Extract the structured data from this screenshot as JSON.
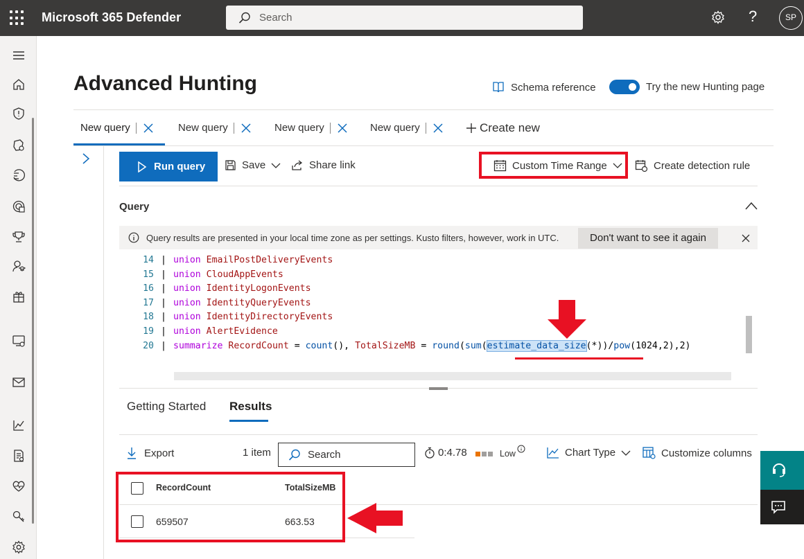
{
  "app": {
    "title": "Microsoft 365 Defender",
    "search_placeholder": "Search",
    "avatar_initials": "SP"
  },
  "nav_icons": [
    "hamburger-icon",
    "home-icon",
    "shield-icon",
    "incidents-icon",
    "hunting-icon",
    "threat-analytics-icon",
    "secure-score-icon",
    "learning-hub-icon",
    "trials-icon",
    "assets-icon",
    "email-icon",
    "reports-icon",
    "audit-icon",
    "health-icon",
    "permissions-icon",
    "settings-icon"
  ],
  "page": {
    "title": "Advanced Hunting",
    "schema_reference": "Schema reference",
    "new_hunting_toggle_label": "Try the new Hunting page",
    "new_hunting_toggle_on": true
  },
  "query_tabs": [
    {
      "label": "New query",
      "active": true
    },
    {
      "label": "New query",
      "active": false
    },
    {
      "label": "New query",
      "active": false
    },
    {
      "label": "New query",
      "active": false
    }
  ],
  "create_new": "Create new",
  "toolbar": {
    "run_query": "Run query",
    "save": "Save",
    "share_link": "Share link",
    "time_range": "Custom Time Range",
    "create_detection_rule": "Create detection rule"
  },
  "query_section": {
    "label": "Query",
    "info_text": "Query results are presented in your local time zone as per settings. Kusto filters, however, work in UTC.",
    "dont_show_button": "Don't want to see it again"
  },
  "code_lines": [
    {
      "n": "14",
      "kw": "union",
      "rest": "EmailPostDeliveryEvents"
    },
    {
      "n": "15",
      "kw": "union",
      "rest": "CloudAppEvents"
    },
    {
      "n": "16",
      "kw": "union",
      "rest": "IdentityLogonEvents"
    },
    {
      "n": "17",
      "kw": "union",
      "rest": "IdentityQueryEvents"
    },
    {
      "n": "18",
      "kw": "union",
      "rest": "IdentityDirectoryEvents"
    },
    {
      "n": "19",
      "kw": "union",
      "rest": "AlertEvidence"
    }
  ],
  "code_last": {
    "n": "20",
    "kw": "summarize",
    "col1": "RecordCount",
    "eq1": " = ",
    "fn1": "count",
    "p1": "(), ",
    "col2": "TotalSizeMB",
    "eq2": " = ",
    "fn2": "round",
    "p2": "(",
    "fn3": "sum",
    "p3": "(",
    "fn4": "estimate_data_size",
    "p4": "(*))/",
    "fn5": "pow",
    "p5": "(1024,2),2)"
  },
  "result_tabs": [
    {
      "label": "Getting Started",
      "active": false
    },
    {
      "label": "Results",
      "active": true
    }
  ],
  "results_toolbar": {
    "export": "Export",
    "item_count": "1 item",
    "search_placeholder": "Search",
    "duration": "0:4.78",
    "resource_usage": "Low",
    "chart_type": "Chart Type",
    "customize_columns": "Customize columns"
  },
  "table": {
    "columns": [
      "RecordCount",
      "TotalSizeMB"
    ],
    "rows": [
      [
        "659507",
        "663.53"
      ]
    ]
  },
  "colors": {
    "accent": "#0f6cbd",
    "annotation_red": "#e81123",
    "topbar": "#3b3a39"
  }
}
